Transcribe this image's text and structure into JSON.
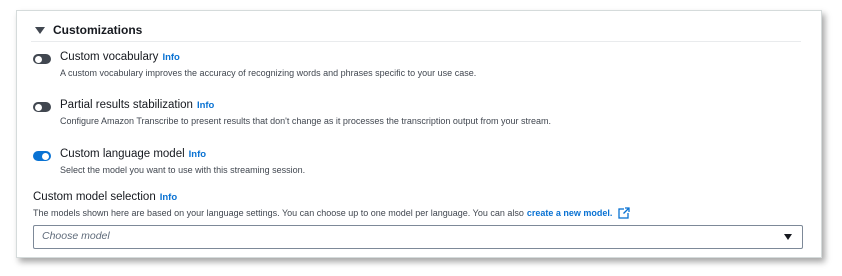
{
  "section": {
    "title": "Customizations"
  },
  "toggles": [
    {
      "label": "Custom vocabulary",
      "info": "Info",
      "description": "A custom vocabulary improves the accuracy of recognizing words and phrases specific to your use case.",
      "enabled": false
    },
    {
      "label": "Partial results stabilization",
      "info": "Info",
      "description": "Configure Amazon Transcribe to present results that don't change as it processes the transcription output from your stream.",
      "enabled": false
    },
    {
      "label": "Custom language model",
      "info": "Info",
      "description": "Select the model you want to use with this streaming session.",
      "enabled": true
    }
  ],
  "model_selection": {
    "label": "Custom model selection",
    "info": "Info",
    "description": "The models shown here are based on your language settings. You can choose up to one model per language. You can also",
    "link": "create a new model.",
    "placeholder": "Choose model"
  },
  "colors": {
    "accent": "#0972d3",
    "toggle_off": "#414750"
  },
  "icons": {
    "collapse": "caret-down-icon",
    "external": "external-link-icon",
    "dropdown": "caret-down-icon"
  }
}
